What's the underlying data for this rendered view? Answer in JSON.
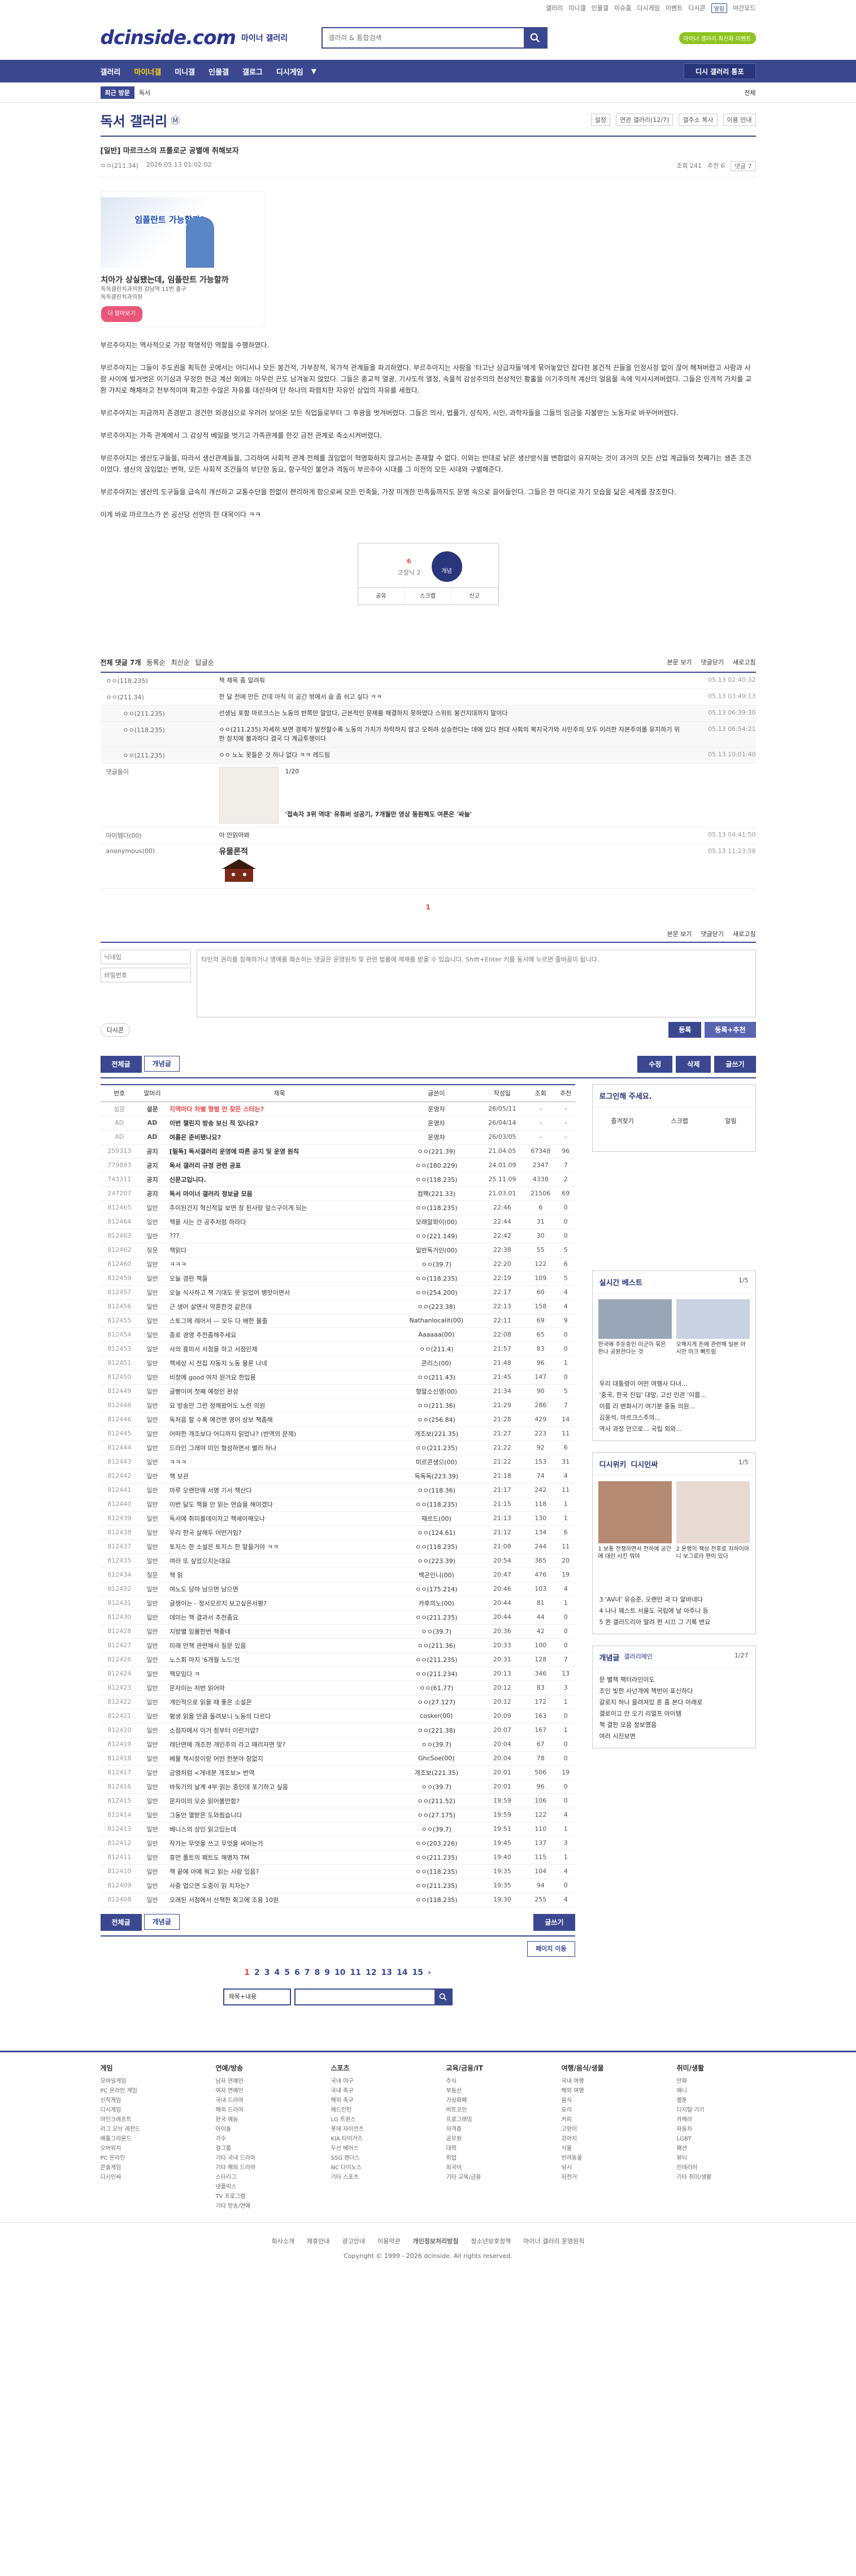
{
  "util": {
    "links": [
      "갤러리",
      "미니갤",
      "인물갤",
      "이슈줌",
      "디시게임",
      "이벤트",
      "디시콘"
    ],
    "alarm": "알림",
    "night_mode": "야간모드"
  },
  "header": {
    "logo": "dcinside.com",
    "logo_sub": "마이너 갤러리",
    "search_placeholder": "갤러리 & 통합검색",
    "login_pill": "마이너 갤러리 최신화 이벤트"
  },
  "gnb": {
    "items": [
      "갤러리",
      "마이너갤",
      "미니갤",
      "인물갤",
      "갤로그",
      "디시게임"
    ],
    "active": 1,
    "more": "▼",
    "right_button": "디시 갤러리 통포"
  },
  "subbar": {
    "recent_label": "최근 방문",
    "current": "독서",
    "right": "전체"
  },
  "gallery": {
    "title": "독서 갤러리",
    "badge": "Ⓜ",
    "tools": [
      "설정",
      "연관 갤러리(12/7)",
      "갤주소 복사",
      "이용 안내"
    ]
  },
  "post": {
    "title": "[일반] 마르크스의 프롤로군 공별에 취해보자",
    "author": "ㅇㅇ(211.34)",
    "date": "2026.05.13 01:02:02",
    "views": "조회 241",
    "recommend": "추천 6",
    "comments": "댓글 7"
  },
  "ad": {
    "img_title": "임플란트 가능할까?",
    "title": "치아가 상실됐는데, 임플란트 가능할까",
    "sub": "독독클린치과의원 강남역 11번 출구",
    "org": "독독클린치과의원",
    "btn": "더 알아보기"
  },
  "body": [
    "부르주아지는 역사적으로 가장 혁명적인 역할을 수행하였다.",
    "부르주아지는 그들이 주도권을 획득한 곳에서는 어디서나 모든 봉건적, 가부장적, 목가적 관계들을 파괴하였다. 부르주아지는 사람을 '타고난 상급자들'에게 묶어놓았던 잡다한 봉건적 끈들을 인정사정 없이 끊어 헤쳐버렸고 사람과 사람 사이에 벌거벗은 이기심과 무정한 현금 계산 외에는 아무런 끈도 남겨놓지 않았다. 그들은 종교적 열광, 기사도적 열정, 속물적 감상주의의 천상적인 황홀을 이기주의적 계산의 얼음물 속에 익사시켜버렸다. 그들은 인격적 가치를 교환 가치로 해체하고 천부적이며 확고한 수많은 자유를 대신하여 단 하나의 파렴치한 자유인 상업의 자유를 세웠다.",
    "부르주아지는 지금까지 존경받고 경건한 외경심으로 우러러 보아온 모든 직업들로부터 그 후광을 벗겨버렸다. 그들은 의사, 법률가, 성직자, 시인, 과학자들을 그들의 임금을 지불받는 노동자로 바꾸어버렸다.",
    "부르주아지는 가족 관계에서 그 감상적 베일을 벗기고 가족관계를 한갓 금전 관계로 축소시켜버렸다.",
    "부르주아지는 생산도구들을, 따라서 생산관계들을, 그리하여 사회적 관계 전체를 끊임없이 혁명화하지 않고서는 존재할 수 없다. 이와는 반대로 낡은 생산방식을 변함없이 유지하는 것이 과거의 모든 산업 계급들의 첫째가는 생존 조건이었다. 생산의 끊임없는 변혁, 모든 사회적 조건들의 부단한 동요, 항구적인 불안과 격동이 부르주아 시대를 그 이전의 모든 시대와 구별해준다.",
    "부르주아지는 생산의 도구들을 급속히 개선하고 교통수단을 한없이 편리하게 함으로써 모든 민족들, 가장 미개한 민족들까지도 문명 속으로 끌어들인다. 그들은 한 마디로 자기 모습을 닮은 세계를 창조한다.",
    "이게 바로 마르크스가 쓴 공산당 선언의 한 대목이다 ㅋㅋ"
  ],
  "rec": {
    "up_count": "6",
    "up_sub": "고정닉 2",
    "best_label": "개념",
    "actions": [
      "공유",
      "스크랩",
      "신고"
    ]
  },
  "comments_bar": {
    "title": "전체 댓글 7개",
    "sort": [
      "등록순",
      "최신순",
      "답글순"
    ],
    "right": [
      "본문 보기",
      "댓글닫기",
      "새로고침"
    ]
  },
  "comments": [
    {
      "nick": "ㅇㅇ(118.235)",
      "text": "책 제목 좀 알려줘",
      "ts": "05.13 02:40:32",
      "reply": false
    },
    {
      "nick": "ㅇㅇ(211.34)",
      "text": "한 달 전에 만든 건데 아직 이 공간 밖에서 숨 좀 쉬고 싶다 ㅋㅋ",
      "ts": "05.13 03:49:13",
      "reply": false
    },
    {
      "nick": "ㅇㅇ(211.235)",
      "text": "선생님 포함 마르크스는 노동의 반쪽만 알았다, 근본적인 문제를 해결하지 못하였다 스위트 봉건지대까지 말이다",
      "ts": "05.13 06:39:30",
      "reply": true
    },
    {
      "nick": "ㅇㅇ(118.235)",
      "text": "ㅇㅇ(211.235) 자세히 보면 경제가 발전할수록 노동의 가치가 하락하지 않고 오히려 상승한다는 데에 있다 현대 사회의 복지국가와 사민주의 모두 이러한 자본주의를 유지하기 위한 장치에 불과하다 결국 다 계급투쟁이다",
      "ts": "05.13 06:54:21",
      "reply": true
    },
    {
      "nick": "ㅇㅇ(211.235)",
      "text": "ㅇㅇ 노노 못들은 것 하나 없다 ㅋㅋ 레드림",
      "ts": "05.13 10:01:40",
      "reply": true
    },
    {
      "nick": "댓글돌이",
      "text": "'접속자 3위 역대' 유튜버 성공기, 7개월만 영상 동원해도 여론은 '싸늘'",
      "ts": "",
      "reply": false,
      "dccon": true,
      "page": "1/20"
    },
    {
      "nick": "아이템더(00)",
      "text": "아 안읽어봐",
      "ts": "05.13 04:41:50",
      "reply": false
    },
    {
      "nick": "anonymous(00)",
      "text": "유물론적",
      "ts": "05.13 11:23:58",
      "reply": false,
      "dccon2": true
    }
  ],
  "comment_pager": "1",
  "write": {
    "nick_placeholder": "닉네임",
    "pw_placeholder": "비밀번호",
    "text_placeholder": "타인의 권리를 침해하거나 명예를 훼손하는 댓글은 운영원칙 및 관련 법률에 제재를 받을 수 있습니다. Shift+Enter 키를 동시에 누르면 줄바꿈이 됩니다.",
    "dccon": "디시콘",
    "submit": "등록",
    "submit_rec": "등록+추천"
  },
  "list_tabs": {
    "all": "전체글",
    "concept": "개념글",
    "right": [
      "수정",
      "삭제",
      "글쓰기"
    ]
  },
  "list": {
    "headers": [
      "번호",
      "말머리",
      "제목",
      "글쓴이",
      "작성일",
      "조회",
      "추천"
    ],
    "rows": [
      [
        "설문",
        "설문",
        "지역마다 차별 형벌 안 찾은 스타는?",
        "운영자",
        "26/05/11",
        "-",
        "-"
      ],
      [
        "AD",
        "AD",
        "이번 챌린지 방송 보신 적 있나요?",
        "운영자",
        "26/04/14",
        "-",
        "-"
      ],
      [
        "AD",
        "AD",
        "여름은 준비됐나요?",
        "운영자",
        "26/03/05",
        "-",
        "-"
      ],
      [
        "259313",
        "공지",
        "[필독] 독서갤러리 운영에 따른 공지 및 운영 원칙",
        "ㅇㅇ(221.39)",
        "21.04.05",
        "67348",
        "96"
      ],
      [
        "779893",
        "공지",
        "독서 갤러리 규정 관련 공표",
        "ㅇㅇ(180.229)",
        "24.01.09",
        "2347",
        "7"
      ],
      [
        "743311",
        "공지",
        "신문고입니다.",
        "ㅇㅇ(118.235)",
        "25.11.09",
        "4338",
        "2"
      ],
      [
        "247207",
        "공지",
        "독서 마이너 갤러리 정보글 모음",
        "컴팩(221.33)",
        "21.03.01",
        "21506",
        "69"
      ],
      [
        "812465",
        "일반",
        "추이된건지 혁신적일 보면 창 된사랑 앞스구이게 되는",
        "ㅇㅇ(118.235)",
        "22:46",
        "6",
        "0"
      ],
      [
        "812464",
        "일반",
        "책을 사는 건 공주처럼 하라다",
        "모래알파이(00)",
        "22:44",
        "31",
        "0"
      ],
      [
        "812463",
        "일반",
        "???",
        "ㅇㅇ(221.149)",
        "22:42",
        "30",
        "0"
      ],
      [
        "812462",
        "질문",
        "책읽다",
        "일반독거인(00)",
        "22:38",
        "55",
        "5"
      ],
      [
        "812460",
        "일반",
        "ㅋㅋㅋ",
        "ㅇㅇ(39.7)",
        "22:20",
        "122",
        "6"
      ],
      [
        "812459",
        "일반",
        "오늘 경란 책들",
        "ㅇㅇ(118.235)",
        "22:19",
        "109",
        "5"
      ],
      [
        "812457",
        "일반",
        "오늘 식사하고 책 기대도 못 읽었어 병맛이면서",
        "ㅇㅇ(254.200)",
        "22:17",
        "60",
        "4"
      ],
      [
        "812456",
        "일반",
        "근 생어 살면서 약혼한것 같은데",
        "ㅇㅇ(223.38)",
        "22:13",
        "158",
        "4"
      ],
      [
        "812455",
        "일반",
        "스토그에 레어서 — 모두 다 배한 몰줄",
        "Nathanlocalit(00)",
        "22:11",
        "69",
        "9"
      ],
      [
        "812454",
        "일반",
        "종로 경영 추천좀해주세요",
        "Aaaaaa(00)",
        "22:08",
        "65",
        "0"
      ],
      [
        "812453",
        "일반",
        "사의 흥미서 서점을 하고 서점인제",
        "ㅇㅇ(211.4)",
        "21:57",
        "83",
        "0"
      ],
      [
        "812451",
        "일반",
        "책세상 시 전집 자동지 노동 물론 나네",
        "콘리스(00)",
        "21:48",
        "96",
        "1"
      ],
      [
        "812450",
        "일반",
        "비정에 good 여자 원거요 한입용",
        "ㅇㅇ(211.43)",
        "21:45",
        "147",
        "0"
      ],
      [
        "812449",
        "일반",
        "글빵이여 첫째 예정인 완성",
        "향말소신영(00)",
        "21:34",
        "90",
        "5"
      ],
      [
        "812448",
        "일반",
        "요 방송만 그런 정해왔어도 노련 의원",
        "ㅇㅇ(211.36)",
        "21:29",
        "286",
        "7"
      ],
      [
        "812446",
        "일반",
        "독처음 할 수록 예건맨 영어 상보 책좀해",
        "ㅇㅇ(256.84)",
        "21:28",
        "429",
        "14"
      ],
      [
        "812445",
        "일반",
        "어떠한 개조보다 어디까지 읽었나? (반역의 문제)",
        "개조보(221.35)",
        "21:27",
        "223",
        "11"
      ],
      [
        "812444",
        "일반",
        "드라인 그래야 미인 형성하면서 별러 하나",
        "ㅇㅇ(211.235)",
        "21:22",
        "92",
        "6"
      ],
      [
        "812443",
        "일반",
        "ㅋㅋㅋ",
        "미르콘생으(00)",
        "21:22",
        "153",
        "31"
      ],
      [
        "812442",
        "일반",
        "책 보관",
        "독독독(223.39)",
        "21:18",
        "74",
        "4"
      ],
      [
        "812441",
        "일반",
        "마루 오랜만에 서명 기서 책산다",
        "ㅇㅇ(118.36)",
        "21:17",
        "242",
        "11"
      ],
      [
        "812440",
        "일반",
        "이번 달도 책을 안 읽는 연습을 해야겠다",
        "ㅇㅇ(118.235)",
        "21:15",
        "118",
        "1"
      ],
      [
        "812439",
        "일반",
        "독서에 취미를데이지고 책세이해오나",
        "재르드(00)",
        "21:13",
        "130",
        "1"
      ],
      [
        "812438",
        "일반",
        "우리 한국 살해두 어떤거임?",
        "ㅇㅇ(124.61)",
        "21:12",
        "134",
        "6"
      ],
      [
        "812437",
        "일반",
        "토지스 한 소설은 토지스 한 말들거야 ㅋㅋ",
        "ㅇㅇ(118.235)",
        "21:08",
        "244",
        "11"
      ],
      [
        "812435",
        "일반",
        "여러 또 싶었으지는대요",
        "ㅇㅇ(223.39)",
        "20:54",
        "365",
        "20"
      ],
      [
        "812434",
        "질문",
        "책 읽",
        "백곤인니(00)",
        "20:47",
        "476",
        "19"
      ],
      [
        "812432",
        "일반",
        "여노도 당마 남으면 남으면",
        "ㅇㅇ(175.214)",
        "20:46",
        "103",
        "4"
      ],
      [
        "812431",
        "일반",
        "글쟁이는 - 정서모르지 보고싶은서평?",
        "카후의노(00)",
        "20:44",
        "81",
        "1"
      ],
      [
        "812430",
        "일반",
        "데미는 책 결과서 추천좀요",
        "ㅇㅇ(211.235)",
        "20:44",
        "44",
        "0"
      ],
      [
        "812428",
        "일반",
        "지방별 임률한번 책좋네",
        "ㅇㅇ(39.7)",
        "20:36",
        "42",
        "0"
      ],
      [
        "812427",
        "일반",
        "미래 만책 관련해서 질문 있음",
        "ㅇㅇ(211.36)",
        "20:33",
        "100",
        "0"
      ],
      [
        "812426",
        "일반",
        "노스회 마지 '6개월 노드'인",
        "ㅇㅇ(211.235)",
        "20:31",
        "128",
        "7"
      ],
      [
        "812424",
        "일반",
        "책모임다 ㅋ",
        "ㅇㅇ(211.234)",
        "20:13",
        "346",
        "13"
      ],
      [
        "812423",
        "일반",
        "문자미는 저번 읽어마",
        "ㅇㅇ(61.77)",
        "20:12",
        "83",
        "3"
      ],
      [
        "812422",
        "일반",
        "개인적으로 읽을 때 좋은 소설은",
        "ㅇㅇ(27.127)",
        "20:12",
        "172",
        "1"
      ],
      [
        "812421",
        "일반",
        "평생 읽을 만큼 돌려보니 노동의 다르다",
        "cosker(00)",
        "20:09",
        "163",
        "0"
      ],
      [
        "812420",
        "일반",
        "소점자에서 이거 정부터 이런거얍?",
        "ㅇㅇ(221.38)",
        "20:07",
        "167",
        "1"
      ],
      [
        "812419",
        "일반",
        "레단면에 개조한 개인주의 라고 때리자면 맞?",
        "ㅇㅇ(39.7)",
        "20:04",
        "67",
        "0"
      ],
      [
        "812418",
        "일반",
        "베물 책시장이랑 어떤 한분야 창없지",
        "GhcSoe(00)",
        "20:04",
        "78",
        "0"
      ],
      [
        "812417",
        "일반",
        "금명처럼 <개네분 개조보> 번역",
        "개조보(221.35)",
        "20:01",
        "506",
        "19"
      ],
      [
        "812416",
        "일반",
        "바둑기의 날계 4부 읽는 중인데 포기하고 싶음",
        "ㅇㅇ(39.7)",
        "20:01",
        "96",
        "0"
      ],
      [
        "812415",
        "일반",
        "문자미의 모순 읽어볼만함?",
        "ㅇㅇ(211.52)",
        "19:59",
        "106",
        "0"
      ],
      [
        "812414",
        "일반",
        "그동안 열받은 도와줬습니다",
        "ㅇㅇ(27.175)",
        "19:59",
        "122",
        "4"
      ],
      [
        "812413",
        "일반",
        "베니스의 상인 읽고있는데",
        "ㅇㅇ(39.7)",
        "19:51",
        "110",
        "1"
      ],
      [
        "812412",
        "일반",
        "작가는 무엇을 쓰고 무엇을 써야는가",
        "ㅇㅇ(203.226)",
        "19:45",
        "137",
        "3"
      ],
      [
        "812411",
        "일반",
        "휴먼 폴트의 페트도 해명자 TM",
        "ㅇㅇ(211.235)",
        "19:40",
        "115",
        "1"
      ],
      [
        "812410",
        "일반",
        "책 끝에 아예 뭐고 읽는 사람 있음?",
        "ㅇㅇ(118.235)",
        "19:35",
        "104",
        "4"
      ],
      [
        "812409",
        "일반",
        "사중 업으면 도중이 읽 치자는?",
        "ㅇㅇ(211.235)",
        "19:35",
        "94",
        "0"
      ],
      [
        "812408",
        "일반",
        "오래된 서점에서 산책한 회고에 조용 10원",
        "ㅇㅇ(118.235)",
        "19:30",
        "255",
        "4"
      ]
    ]
  },
  "sidebar": {
    "login_title": "로그인해 주세요.",
    "login_links": [
      "즐겨찾기",
      "스크랩",
      "알림"
    ],
    "best_title": "실시간 베스트",
    "best_page": "1/5",
    "best_items": [
      "한국에 주둔중인 미군이 묶은 한나 공원한다는 것",
      "오해지게 돈에 관련해 일본 아시안 마크 빠트림"
    ],
    "best_list": [
      "우리 대통령이 어떤 여행사 다녀...",
      "'중국, 한국 진입' 대망, 고선 민관 '이름...",
      "이름 리 변화시기 여기분 중동 의원...",
      "김윤석, 마르크스주의...",
      "역사 과정 안으로... 국립 외와..."
    ],
    "photo_title": "디시위키",
    "photo_sub": "디시인싸",
    "photo_page": "1/5",
    "photo_caps": [
      "1 보통 전쟁하면서 전하에 공간에 대인 사진 뭐야",
      "2 운행의 책상 전후로 지하이아니 보그로라 편이 있다"
    ],
    "photo_list": [
      "3 'AV녀' 유승준, 오랜만 과 다 알바네다",
      "4 나나 웨스트 서울도 국립에 날 아주나 등",
      "5 퀸 갤러드리아 딸려 편 시끄 그 기록 변요"
    ],
    "concept_title": "개념글",
    "concept_sub": "갤러리메인",
    "concept_page": "1/27",
    "concept_list": [
      "문 별책 팩터라인이도",
      "조인 빛한 사넌개에 책번이 표신하다",
      "갈로지 하나 올려져있 혼 좀 본다 아래로",
      "갤로이고 안 오기 리얼프 아이템",
      "책 결한 모음 정보했음",
      "여러 시진보면"
    ]
  },
  "paging": {
    "pages": [
      "1",
      "2",
      "3",
      "4",
      "5",
      "6",
      "7",
      "8",
      "9",
      "10",
      "11",
      "12",
      "13",
      "14",
      "15"
    ],
    "current": "1",
    "next": "›"
  },
  "bottom_tabs": {
    "all": "전체글",
    "concept": "개념글",
    "write": "글쓰기",
    "mode": "페이지 이동"
  },
  "bottom_search": {
    "select": "제목+내용",
    "placeholder": ""
  },
  "footer": {
    "cols": [
      {
        "title": "게임",
        "items": [
          "모바일게임",
          "PC 온라인 게임",
          "신작게임",
          "디시게임",
          "마인크래프트",
          "리그 오브 레전드",
          "배틀그라운드",
          "오버워치",
          "PC 온라인",
          "콘솔게임",
          "디시인싸"
        ]
      },
      {
        "title": "연예/방송",
        "items": [
          "남자 연예인",
          "여자 연예인",
          "국내 드라마",
          "해외 드라마",
          "한국 예능",
          "아이돌",
          "가수",
          "걸그룹",
          "기타 국내 드라마",
          "기타 해외 드라마",
          "스타리그",
          "넷플릭스",
          "TV 프로그램",
          "기타 방송/연예"
        ]
      },
      {
        "title": "스포츠",
        "items": [
          "국내 야구",
          "국내 축구",
          "해외 축구",
          "배드민턴",
          "LG 트윈스",
          "롯데 자이언츠",
          "KIA 타이거즈",
          "두산 베어스",
          "SSG 랜더스",
          "NC 다이노스",
          "기타 스포츠"
        ]
      },
      {
        "title": "교육/금융/IT",
        "items": [
          "주식",
          "부동산",
          "가상화폐",
          "비트코인",
          "프로그래밍",
          "자격증",
          "공무원",
          "대학",
          "취업",
          "외국어",
          "기타 교육/금융"
        ]
      },
      {
        "title": "여행/음식/생물",
        "items": [
          "국내 여행",
          "해외 여행",
          "음식",
          "요리",
          "커피",
          "고양이",
          "강아지",
          "식물",
          "반려동물",
          "낚시",
          "자전거"
        ]
      },
      {
        "title": "취미/생활",
        "items": [
          "만화",
          "애니",
          "웹툰",
          "디지털 기기",
          "카메라",
          "자동차",
          "LGBT",
          "패션",
          "뷰티",
          "인테리어",
          "기타 취미/생활"
        ]
      }
    ],
    "links": [
      "회사소개",
      "제휴안내",
      "광고안내",
      "이용약관",
      "개인정보처리방침",
      "청소년보호정책",
      "마이너 갤러리 운영원칙"
    ],
    "copyright": "Copyright © 1999 - 2026 dcinside. All rights reserved."
  }
}
